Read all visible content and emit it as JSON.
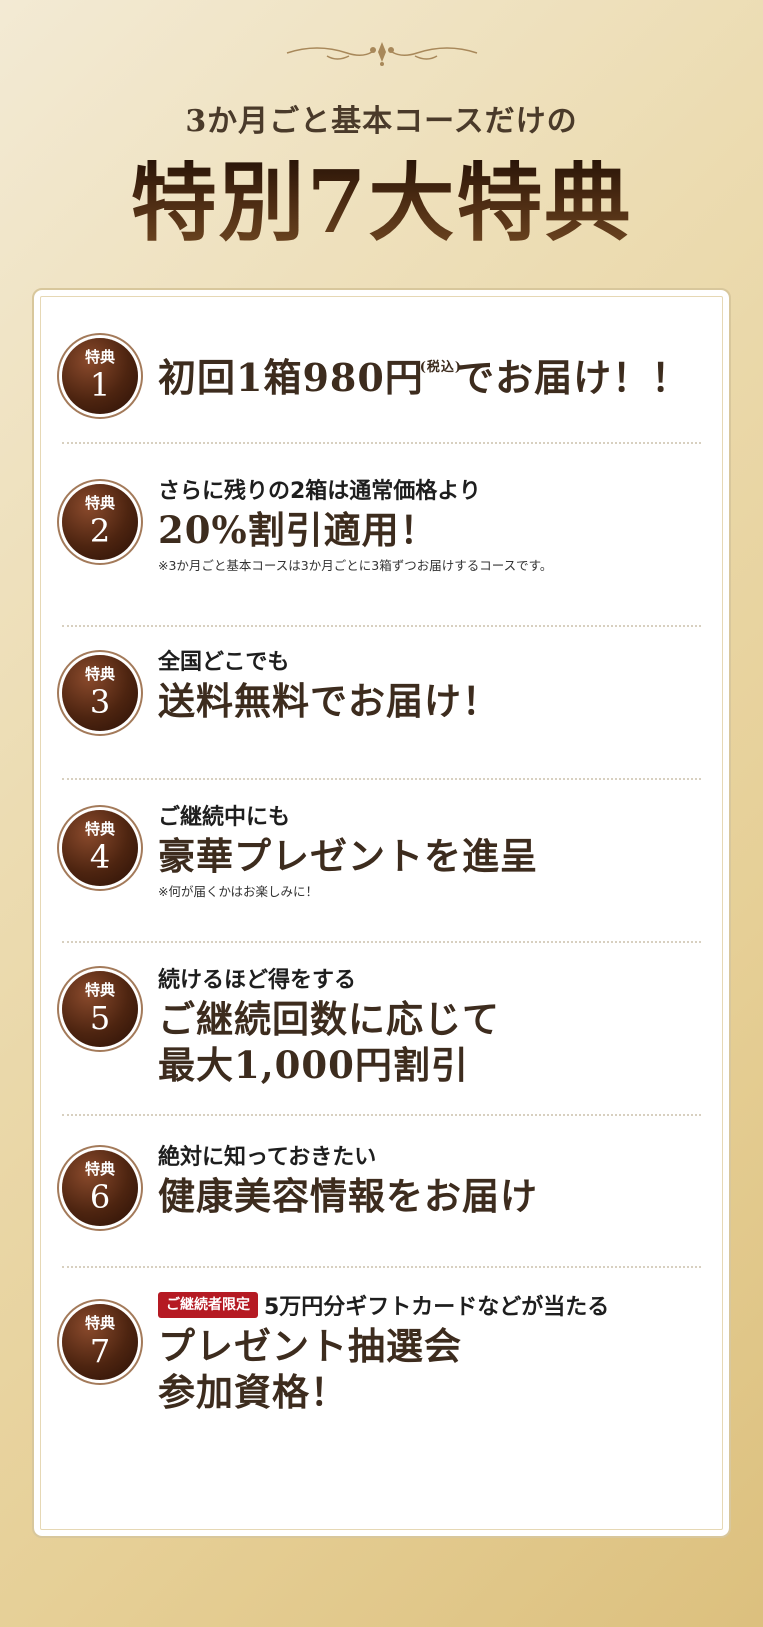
{
  "header": {
    "subtitle": "3か月ごと基本コースだけの",
    "title": "特別7大特典"
  },
  "badge_label": "特典",
  "items": [
    {
      "number": "1",
      "big_a": "初回1箱980円",
      "tax": "(税込)",
      "big_b": "でお届け！！"
    },
    {
      "number": "2",
      "small": "さらに残りの2箱は通常価格より",
      "big": "20%割引適用！",
      "note": "※3か月ごと基本コースは3か月ごとに3箱ずつお届けするコースです。"
    },
    {
      "number": "3",
      "small": "全国どこでも",
      "big": "送料無料でお届け！"
    },
    {
      "number": "4",
      "small": "ご継続中にも",
      "big": "豪華プレゼントを進呈",
      "note": "※何が届くかはお楽しみに！"
    },
    {
      "number": "5",
      "small": "続けるほど得をする",
      "big_1": "ご継続回数に応じて",
      "big_2": "最大1,000円割引"
    },
    {
      "number": "6",
      "small": "絶対に知っておきたい",
      "big": "健康美容情報をお届け"
    },
    {
      "number": "7",
      "tag": "ご継続者限定",
      "small": "5万円分ギフトカードなどが当たる",
      "big_1": "プレゼント抽選会",
      "big_2": "参加資格！"
    }
  ],
  "colors": {
    "badge": "#4d2410",
    "title": "#3a1e0c",
    "tag": "#b51a23"
  }
}
